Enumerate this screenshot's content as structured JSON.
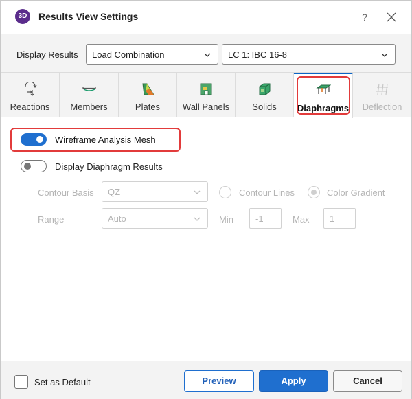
{
  "window": {
    "title": "Results View Settings",
    "logo_text": "3D",
    "help_label": "?"
  },
  "display_results": {
    "label": "Display Results",
    "result_type": "Load Combination",
    "combination": "LC 1: IBC 16-8"
  },
  "tabs": [
    {
      "label": "Reactions",
      "icon": "reactions-icon",
      "state": "normal"
    },
    {
      "label": "Members",
      "icon": "members-icon",
      "state": "normal"
    },
    {
      "label": "Plates",
      "icon": "plates-icon",
      "state": "normal"
    },
    {
      "label": "Wall Panels",
      "icon": "wall-panels-icon",
      "state": "normal"
    },
    {
      "label": "Solids",
      "icon": "solids-icon",
      "state": "normal"
    },
    {
      "label": "Diaphragms",
      "icon": "diaphragms-icon",
      "state": "active"
    },
    {
      "label": "Deflection",
      "icon": "deflection-icon",
      "state": "disabled"
    }
  ],
  "diaphragms": {
    "wireframe_label": "Wireframe Analysis Mesh",
    "wireframe_on": true,
    "display_results_label": "Display Diaphragm Results",
    "display_results_on": false,
    "contour_basis_label": "Contour Basis",
    "contour_basis_value": "QZ",
    "contour_lines_label": "Contour Lines",
    "color_gradient_label": "Color Gradient",
    "color_gradient_selected": true,
    "range_label": "Range",
    "range_value": "Auto",
    "min_label": "Min",
    "min_value": "-1",
    "max_label": "Max",
    "max_value": "1"
  },
  "footer": {
    "default_label": "Set as Default",
    "default_checked": false,
    "preview_label": "Preview",
    "apply_label": "Apply",
    "cancel_label": "Cancel"
  },
  "colors": {
    "accent": "#1f6fcf",
    "highlight": "#e23b3b",
    "logo": "#5b2d8c"
  }
}
